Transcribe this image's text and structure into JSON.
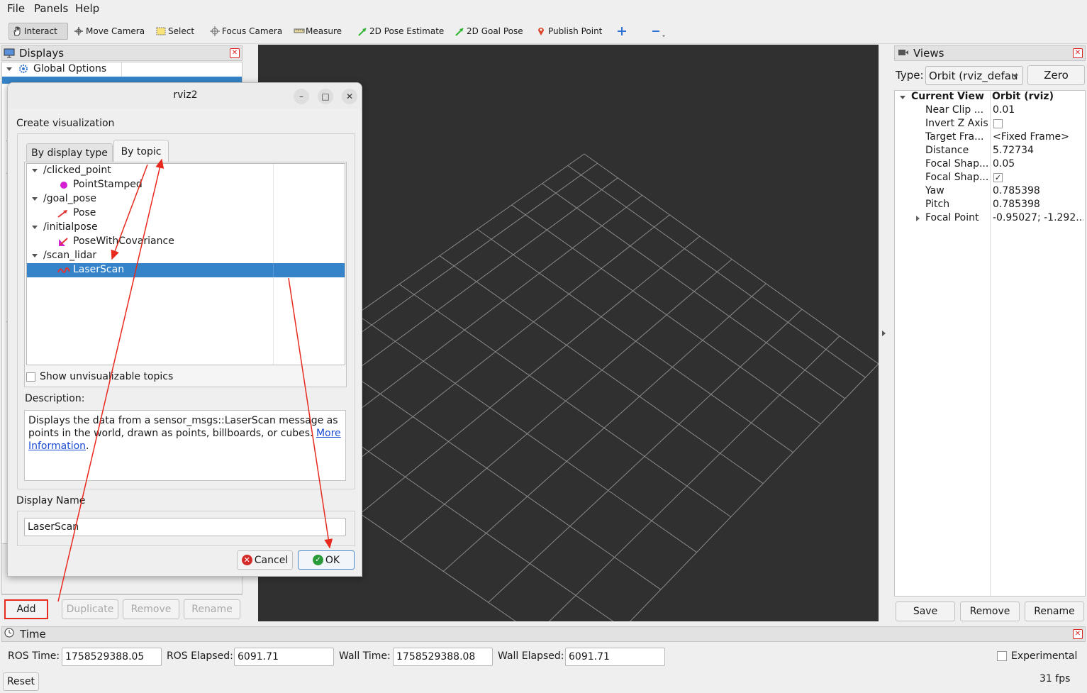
{
  "menubar": {
    "items": [
      "File",
      "Panels",
      "Help"
    ]
  },
  "toolbar": {
    "interact": "Interact",
    "move_camera": "Move Camera",
    "select": "Select",
    "focus_camera": "Focus Camera",
    "measure": "Measure",
    "pose_estimate": "2D Pose Estimate",
    "goal_pose": "2D Goal Pose",
    "publish_point": "Publish Point"
  },
  "displays": {
    "title": "Displays",
    "global_options": "Global Options",
    "add": "Add",
    "duplicate": "Duplicate",
    "remove": "Remove",
    "rename": "Rename"
  },
  "views": {
    "title": "Views",
    "type_label": "Type:",
    "type_value": "Orbit (rviz_defau",
    "zero": "Zero",
    "header_name": "Current View",
    "header_value": "Orbit (rviz)",
    "props": [
      {
        "name": "Near Clip ...",
        "value": "0.01"
      },
      {
        "name": "Invert Z Axis",
        "value": ""
      },
      {
        "name": "Target Fra...",
        "value": "<Fixed Frame>"
      },
      {
        "name": "Distance",
        "value": "5.72734"
      },
      {
        "name": "Focal Shap...",
        "value": "0.05"
      },
      {
        "name": "Focal Shap...",
        "value": ""
      },
      {
        "name": "Yaw",
        "value": "0.785398"
      },
      {
        "name": "Pitch",
        "value": "0.785398"
      },
      {
        "name": "Focal Point",
        "value": "-0.95027; -1.292..."
      }
    ],
    "save": "Save",
    "remove": "Remove",
    "rename": "Rename"
  },
  "time": {
    "title": "Time",
    "ros_time_label": "ROS Time:",
    "ros_time": "1758529388.05",
    "ros_elapsed_label": "ROS Elapsed:",
    "ros_elapsed": "6091.71",
    "wall_time_label": "Wall Time:",
    "wall_time": "1758529388.08",
    "wall_elapsed_label": "Wall Elapsed:",
    "wall_elapsed": "6091.71",
    "experimental": "Experimental",
    "reset": "Reset",
    "fps": "31 fps"
  },
  "dialog": {
    "title": "rviz2",
    "heading": "Create visualization",
    "tab_display_type": "By display type",
    "tab_by_topic": "By topic",
    "topics": [
      {
        "topic": "/clicked_point",
        "type": "PointStamped"
      },
      {
        "topic": "/goal_pose",
        "type": "Pose"
      },
      {
        "topic": "/initialpose",
        "type": "PoseWithCovariance"
      },
      {
        "topic": "/scan_lidar",
        "type": "LaserScan"
      }
    ],
    "show_unvisualizable": "Show unvisualizable topics",
    "description_label": "Description:",
    "description_text": "Displays the data from a sensor_msgs::LaserScan message as points in the world, drawn as points, billboards, or cubes.",
    "more_info_1": "More",
    "more_info_2": "Information",
    "display_name_label": "Display Name",
    "display_name_value": "LaserScan",
    "cancel": "Cancel",
    "ok": "OK"
  },
  "colors": {
    "selection": "#3584c9",
    "annotation_red": "#e8291e",
    "viewport_bg": "#303030",
    "grid_line": "#8a8a8a"
  }
}
